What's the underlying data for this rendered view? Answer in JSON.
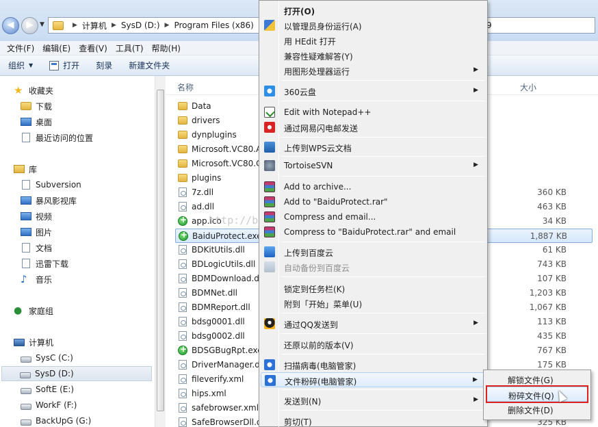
{
  "address": {
    "crumbs": [
      "计算机",
      "SysD (D:)",
      "Program Files (x86)"
    ],
    "tail": "9"
  },
  "menubar": [
    "文件(F)",
    "编辑(E)",
    "查看(V)",
    "工具(T)",
    "帮助(H)"
  ],
  "toolbar": {
    "organize": "组织",
    "open": "打开",
    "burn": "刻录",
    "new_folder": "新建文件夹"
  },
  "nav": {
    "favorites": "收藏夹",
    "downloads": "下载",
    "desktop": "桌面",
    "recent": "最近访问的位置",
    "libraries": "库",
    "subversion": "Subversion",
    "baofeng": "暴风影视库",
    "videos": "视频",
    "pictures": "图片",
    "documents": "文档",
    "xunlei": "迅雷下载",
    "music": "音乐",
    "homegroup": "家庭组",
    "computer": "计算机",
    "drives": [
      "SysC (C:)",
      "SysD (D:)",
      "SoftE (E:)",
      "WorkF (F:)",
      "BackUpG (G:)"
    ]
  },
  "columns": {
    "name": "名称",
    "size": "大小"
  },
  "files": [
    {
      "name": "Data",
      "size": "",
      "type": "folder"
    },
    {
      "name": "drivers",
      "size": "",
      "type": "folder"
    },
    {
      "name": "dynplugins",
      "size": "",
      "type": "folder"
    },
    {
      "name": "Microsoft.VC80.A",
      "size": "",
      "type": "folder"
    },
    {
      "name": "Microsoft.VC80.C",
      "size": "",
      "type": "folder"
    },
    {
      "name": "plugins",
      "size": "",
      "type": "folder"
    },
    {
      "name": "7z.dll",
      "size": "360 KB",
      "type": "file"
    },
    {
      "name": "ad.dll",
      "size": "463 KB",
      "type": "file"
    },
    {
      "name": "app.ico",
      "size": "34 KB",
      "type": "shield"
    },
    {
      "name": "BaiduProtect.exe",
      "size": "1,887 KB",
      "type": "shield"
    },
    {
      "name": "BDKitUtils.dll",
      "size": "61 KB",
      "type": "file"
    },
    {
      "name": "BDLogicUtils.dll",
      "size": "743 KB",
      "type": "file"
    },
    {
      "name": "BDMDownload.d",
      "size": "107 KB",
      "type": "file"
    },
    {
      "name": "BDMNet.dll",
      "size": "1,203 KB",
      "type": "file"
    },
    {
      "name": "BDMReport.dll",
      "size": "1,067 KB",
      "type": "file"
    },
    {
      "name": "bdsg0001.dll",
      "size": "113 KB",
      "type": "file"
    },
    {
      "name": "bdsg0002.dll",
      "size": "435 KB",
      "type": "file"
    },
    {
      "name": "BDSGBugRpt.exe",
      "size": "767 KB",
      "type": "shield"
    },
    {
      "name": "DriverManager.d",
      "size": "175 KB",
      "type": "file"
    },
    {
      "name": "fileverify.xml",
      "size": "",
      "type": "file"
    },
    {
      "name": "hips.xml",
      "size": "",
      "type": "file"
    },
    {
      "name": "safebrowser.xml",
      "size": "",
      "type": "file"
    },
    {
      "name": "SafeBrowserDll.d",
      "size": "325 KB",
      "type": "file"
    }
  ],
  "watermark": "http://blog.csdn.net/testcs_dn",
  "context_menu": {
    "open": "打开(O)",
    "run_as_admin": "以管理员身份运行(A)",
    "hedit": "用 HEdit 打开",
    "compat": "兼容性疑难解答(Y)",
    "gpu": "用图形处理器运行",
    "yunpan360": "360云盘",
    "notepadpp": "Edit with Notepad++",
    "netease": "通过网易闪电邮发送",
    "wps": "上传到WPS云文档",
    "svn": "TortoiseSVN",
    "add_archive": "Add to archive...",
    "add_rar": "Add to \"BaiduProtect.rar\"",
    "compress_email": "Compress and email...",
    "compress_rar_email": "Compress to \"BaiduProtect.rar\" and email",
    "upload_baidu": "上传到百度云",
    "auto_backup_baidu": "自动备份到百度云",
    "pin_taskbar": "锁定到任务栏(K)",
    "pin_start": "附到「开始」菜单(U)",
    "qq_send": "通过QQ发送到",
    "restore": "还原以前的版本(V)",
    "scan_virus": "扫描病毒(电脑管家)",
    "shred": "文件粉碎(电脑管家)",
    "send_to": "发送到(N)",
    "cut": "剪切(T)"
  },
  "submenu": {
    "unlock": "解锁文件(G)",
    "shred_file": "粉碎文件(Q)",
    "delete_file": "删除文件(D)"
  }
}
